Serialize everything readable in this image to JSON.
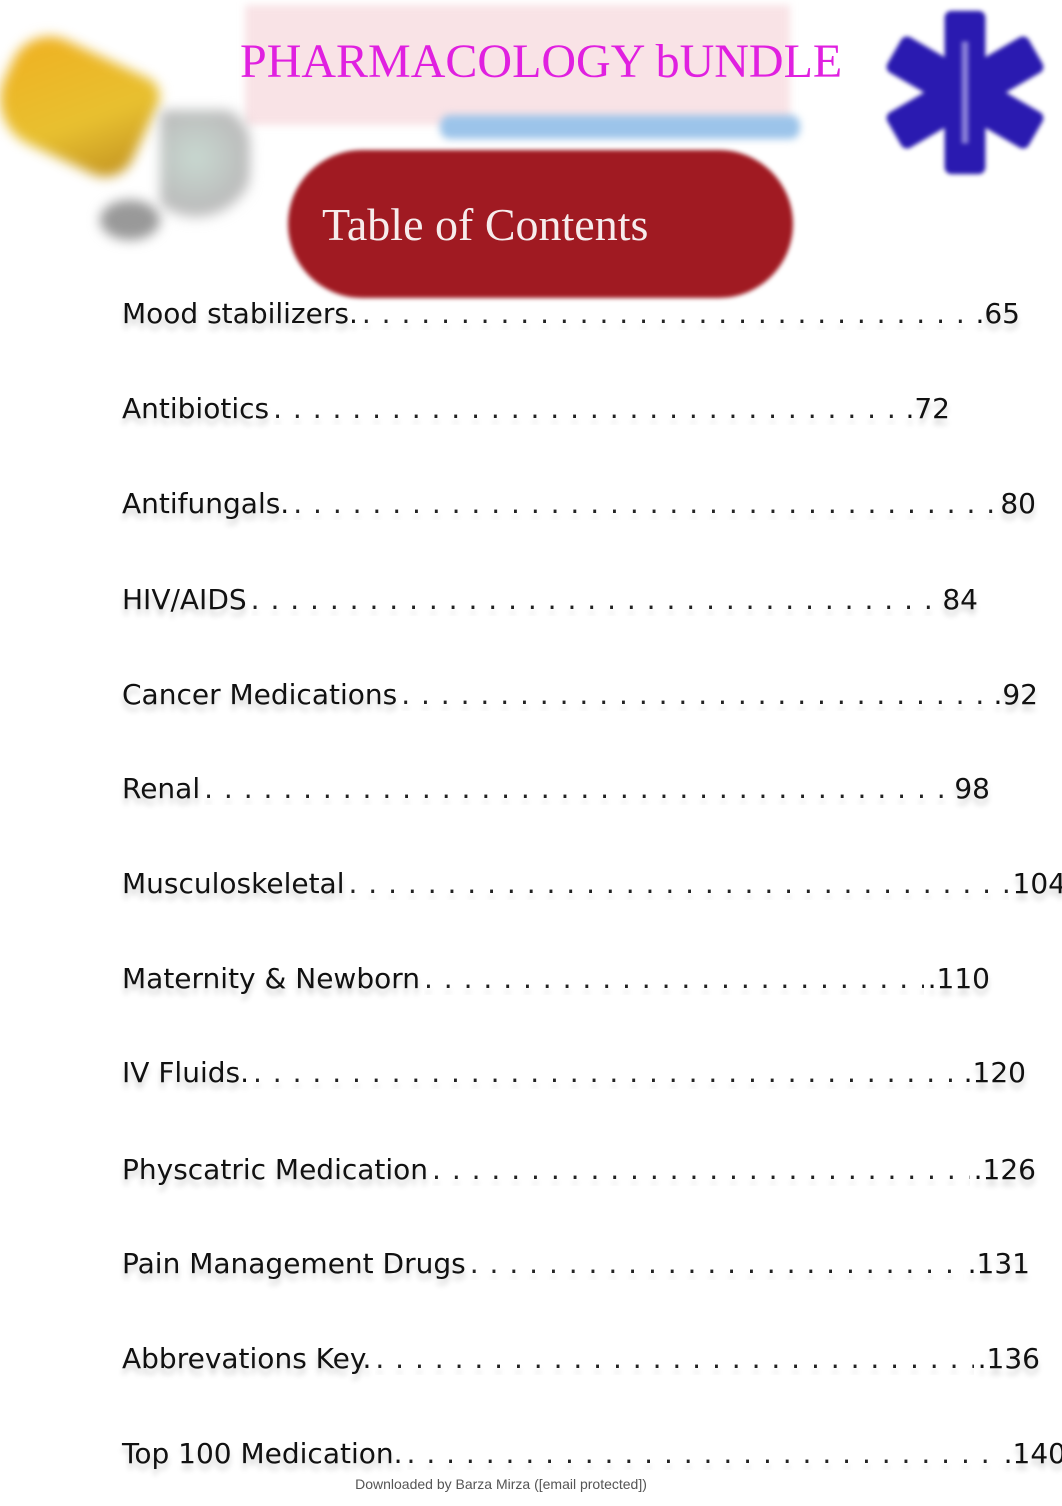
{
  "header": {
    "title": "PHARMACOLOGY bUNDLE",
    "toc_label": "Table of Contents",
    "colors": {
      "title": "#e020e0",
      "toc_pill": "#a01a22",
      "star_of_life": "#2a1ab0"
    }
  },
  "toc": [
    {
      "label": "Mood stabilizers.",
      "page": ".65"
    },
    {
      "label": "Antibiotics",
      "page": ".72"
    },
    {
      "label": "Antifungals.",
      "page": "80"
    },
    {
      "label": "HIV/AIDS",
      "page": "84"
    },
    {
      "label": "Cancer Medications",
      "page": ".92"
    },
    {
      "label": "Renal",
      "page": "98"
    },
    {
      "label": "Musculoskeletal",
      "page": "104"
    },
    {
      "label": "Maternity & Newborn",
      "page": ".110"
    },
    {
      "label": "IV Fluids.",
      "page": ".120"
    },
    {
      "label": "Physcatric Medication",
      "page": ".126"
    },
    {
      "label": "Pain Management Drugs",
      "page": ".131"
    },
    {
      "label": "Abbrevations Key.",
      "page": ".136"
    },
    {
      "label": "Top 100 Medication.",
      "page": ".140"
    }
  ],
  "footer": {
    "text": "Downloaded by Barza Mirza ([email protected])"
  }
}
